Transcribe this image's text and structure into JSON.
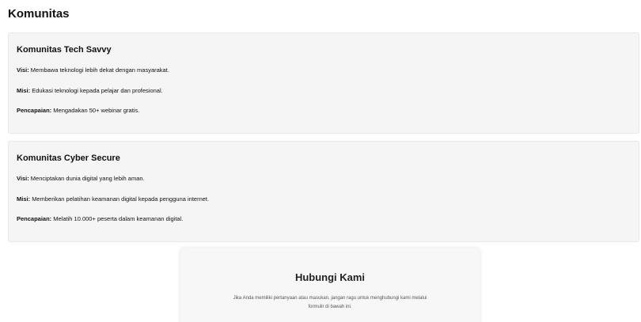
{
  "page": {
    "title": "Komunitas"
  },
  "communities": [
    {
      "name": "Komunitas Tech Savvy",
      "visi_label": "Visi:",
      "visi": "Membawa teknologi lebih dekat dengan masyarakat.",
      "misi_label": "Misi:",
      "misi": "Edukasi teknologi kepada pelajar dan profesional.",
      "pencapaian_label": "Pencapaian:",
      "pencapaian": "Mengadakan 50+ webinar gratis."
    },
    {
      "name": "Komunitas Cyber Secure",
      "visi_label": "Visi:",
      "visi": "Menciptakan dunia digital yang lebih aman.",
      "misi_label": "Misi:",
      "misi": "Memberikan pelatihan keamanan digital kepada pengguna internet.",
      "pencapaian_label": "Pencapaian:",
      "pencapaian": "Melatih 10.000+ peserta dalam keamanan digital."
    }
  ],
  "contact": {
    "title": "Hubungi Kami",
    "line_1": "Jika Anda memiliki pertanyaan atau masukan, jangan ragu untuk menghubungi kami melalui",
    "line_2": "formulir di bawah ini."
  }
}
